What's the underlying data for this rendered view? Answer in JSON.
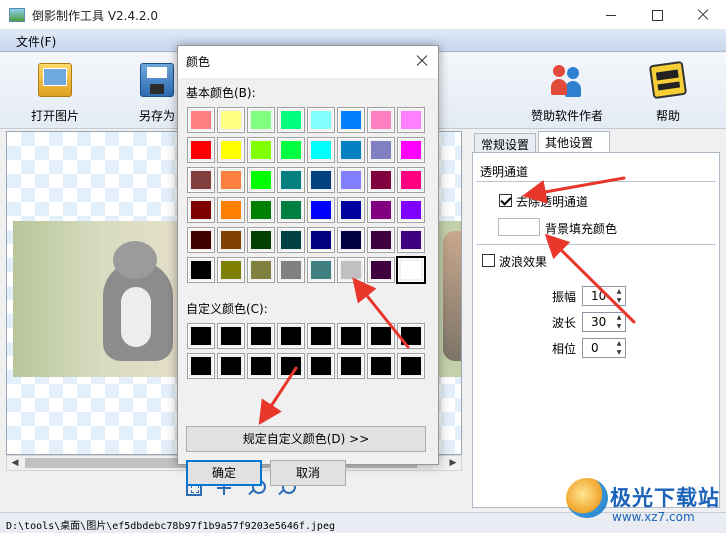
{
  "window": {
    "title": "倒影制作工具 V2.4.2.0"
  },
  "menu": {
    "file": "文件(F)"
  },
  "toolbar": {
    "open_label": "打开图片",
    "save_as_label": "另存为",
    "sponsor_label": "赞助软件作者",
    "help_label": "帮助"
  },
  "tabs": {
    "general": "常规设置",
    "other": "其他设置"
  },
  "settings": {
    "transparency_group": "透明通道",
    "remove_alpha_label": "去除透明通道",
    "remove_alpha_checked": true,
    "bg_fill_label": "背景填充颜色",
    "bg_fill_color": "#ffffff",
    "wave_label": "波浪效果",
    "wave_checked": false,
    "amplitude_label": "振幅",
    "amplitude_value": "10",
    "wavelength_label": "波长",
    "wavelength_value": "30",
    "phase_label": "相位",
    "phase_value": "0"
  },
  "status": {
    "path": "D:\\tools\\桌面\\图片\\ef5dbdebc78b97f1b9a57f9203e5646f.jpeg"
  },
  "dialog": {
    "title": "颜色",
    "basic_colors_label": "基本颜色(B):",
    "custom_colors_label": "自定义颜色(C):",
    "define_custom_button": "规定自定义颜色(D) >>",
    "ok_button": "确定",
    "cancel_button": "取消",
    "selected_index": 47,
    "basic_colors": [
      "#ff8080",
      "#ffff80",
      "#80ff80",
      "#00ff80",
      "#80ffff",
      "#0080ff",
      "#ff80c0",
      "#ff80ff",
      "#ff0000",
      "#ffff00",
      "#80ff00",
      "#00ff40",
      "#00ffff",
      "#0080c0",
      "#8080c0",
      "#ff00ff",
      "#804040",
      "#ff8040",
      "#00ff00",
      "#008080",
      "#004080",
      "#8080ff",
      "#800040",
      "#ff0080",
      "#800000",
      "#ff8000",
      "#008000",
      "#008040",
      "#0000ff",
      "#0000a0",
      "#800080",
      "#8000ff",
      "#400000",
      "#804000",
      "#004000",
      "#004040",
      "#000080",
      "#000040",
      "#400040",
      "#400080",
      "#000000",
      "#808000",
      "#808040",
      "#808080",
      "#408080",
      "#c0c0c0",
      "#400040",
      "#ffffff"
    ],
    "custom_colors": [
      "#000000",
      "#000000",
      "#000000",
      "#000000",
      "#000000",
      "#000000",
      "#000000",
      "#000000",
      "#000000",
      "#000000",
      "#000000",
      "#000000",
      "#000000",
      "#000000",
      "#000000",
      "#000000"
    ]
  },
  "watermark": {
    "name": "极光下载站",
    "url": "www.xz7.com"
  },
  "colors": {
    "accent": "#0078d7",
    "arrow": "#e8362a",
    "menubar": "#c8d7ee"
  }
}
